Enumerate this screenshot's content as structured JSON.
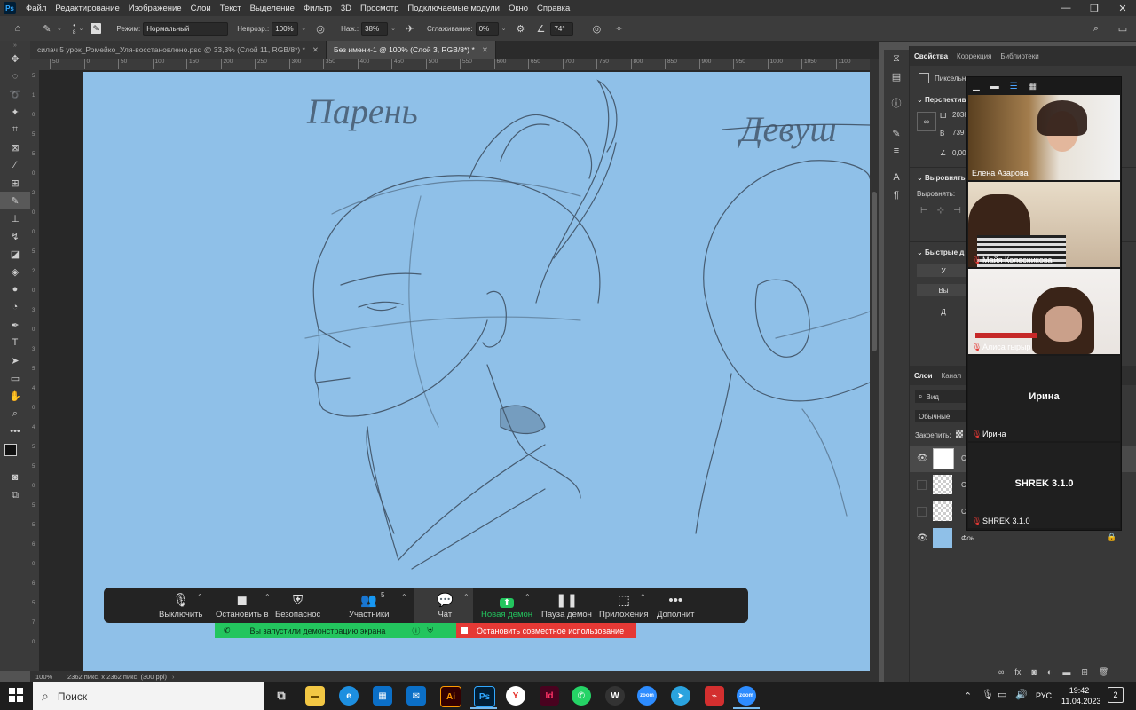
{
  "app": {
    "logo": "Ps"
  },
  "menu": [
    "Файл",
    "Редактирование",
    "Изображение",
    "Слои",
    "Текст",
    "Выделение",
    "Фильтр",
    "3D",
    "Просмотр",
    "Подключаемые модули",
    "Окно",
    "Справка"
  ],
  "window_controls": {
    "minimize": "—",
    "maximize": "❐",
    "close": "✕"
  },
  "options": {
    "brush_size": "8",
    "mode_label": "Режим:",
    "mode_value": "Нормальный",
    "opacity_label": "Непрозр.:",
    "opacity_value": "100%",
    "flow_label": "Наж.:",
    "flow_value": "38%",
    "smoothing_label": "Сглаживание:",
    "smoothing_value": "0%",
    "angle_value": "74°"
  },
  "tabs": [
    {
      "label": "силач 5 урок_Ромейко_Уля-восстановлено.psd @ 33,3% (Слой 11, RGB/8*) *",
      "active": false
    },
    {
      "label": "Без имени-1 @ 100% (Слой 3, RGB/8*) *",
      "active": true
    }
  ],
  "ruler_h": [
    "50",
    "0",
    "50",
    "100",
    "150",
    "200",
    "250",
    "300",
    "350",
    "400",
    "450",
    "500",
    "550",
    "600",
    "650",
    "700",
    "750",
    "800",
    "850",
    "900",
    "950",
    "1000",
    "1050",
    "1100",
    "115"
  ],
  "ruler_v": [
    "5",
    "1",
    "0",
    "5",
    "5",
    "0",
    "2",
    "0",
    "0",
    "5",
    "2",
    "0",
    "3",
    "0",
    "3",
    "5",
    "4",
    "0",
    "4",
    "5",
    "5",
    "0",
    "5",
    "5",
    "6",
    "0",
    "6",
    "5",
    "7",
    "0"
  ],
  "status": {
    "zoom": "100%",
    "doc_info": "2362 пикс. x 2362 пикс. (300 ppi)"
  },
  "panels": {
    "top_tabs": [
      "Свойства",
      "Коррекция",
      "Библиотеки"
    ],
    "pixel_layer": "Пиксельн",
    "perspective": "Перспектив",
    "w_label": "Ш",
    "w_value": "2038",
    "h_label": "В",
    "h_value": "739",
    "pos_value": "0,00",
    "align_title": "Выровнять",
    "align_label": "Выровнять:",
    "quick_title": "Быстрые д",
    "btn1": "У",
    "btn2": "Вы",
    "btn3": "Д",
    "layers_tabs": [
      "Слои",
      "Канал"
    ],
    "layer_search": "Вид",
    "blend_mode": "Обычные",
    "lock_label": "Закрепить:",
    "layers": [
      {
        "name": "С",
        "visible": true
      },
      {
        "name": "С",
        "visible": false
      },
      {
        "name": "С",
        "visible": false
      },
      {
        "name": "Фон",
        "visible": true
      }
    ]
  },
  "zoom_gallery": {
    "participants": [
      {
        "name": "Елена Азарова",
        "muted": false
      },
      {
        "name": "Майя Колесникова",
        "muted": true
      },
      {
        "name": "Алиса гырыр",
        "muted": true
      },
      {
        "name": "Ирина",
        "muted": true,
        "center": "Ирина"
      },
      {
        "name": "SHREK 3.1.0",
        "muted": true,
        "center": "SHREK 3.1.0"
      }
    ]
  },
  "zoom_toolbar": {
    "mute": "Выключить",
    "video": "Остановить в",
    "security": "Безопаснос",
    "participants": "Участники",
    "participants_count": "5",
    "chat": "Чат",
    "share": "Новая демон",
    "pause": "Пауза демон",
    "apps": "Приложения",
    "more": "Дополнит"
  },
  "share_banner": {
    "green_text": "Вы запустили демонстрацию экрана",
    "red_text": "Остановить совместное использование"
  },
  "taskbar": {
    "search_placeholder": "Поиск",
    "lang": "РУС",
    "time": "19:42",
    "date": "11.04.2023",
    "notifications": "2"
  },
  "sketch_texts": {
    "left": "Парень",
    "right": "Девуш"
  },
  "colors": {
    "canvas": "#8fc0e8",
    "zoom_green": "#23c55e",
    "zoom_red": "#e53935",
    "ps_blue": "#31a8ff"
  }
}
